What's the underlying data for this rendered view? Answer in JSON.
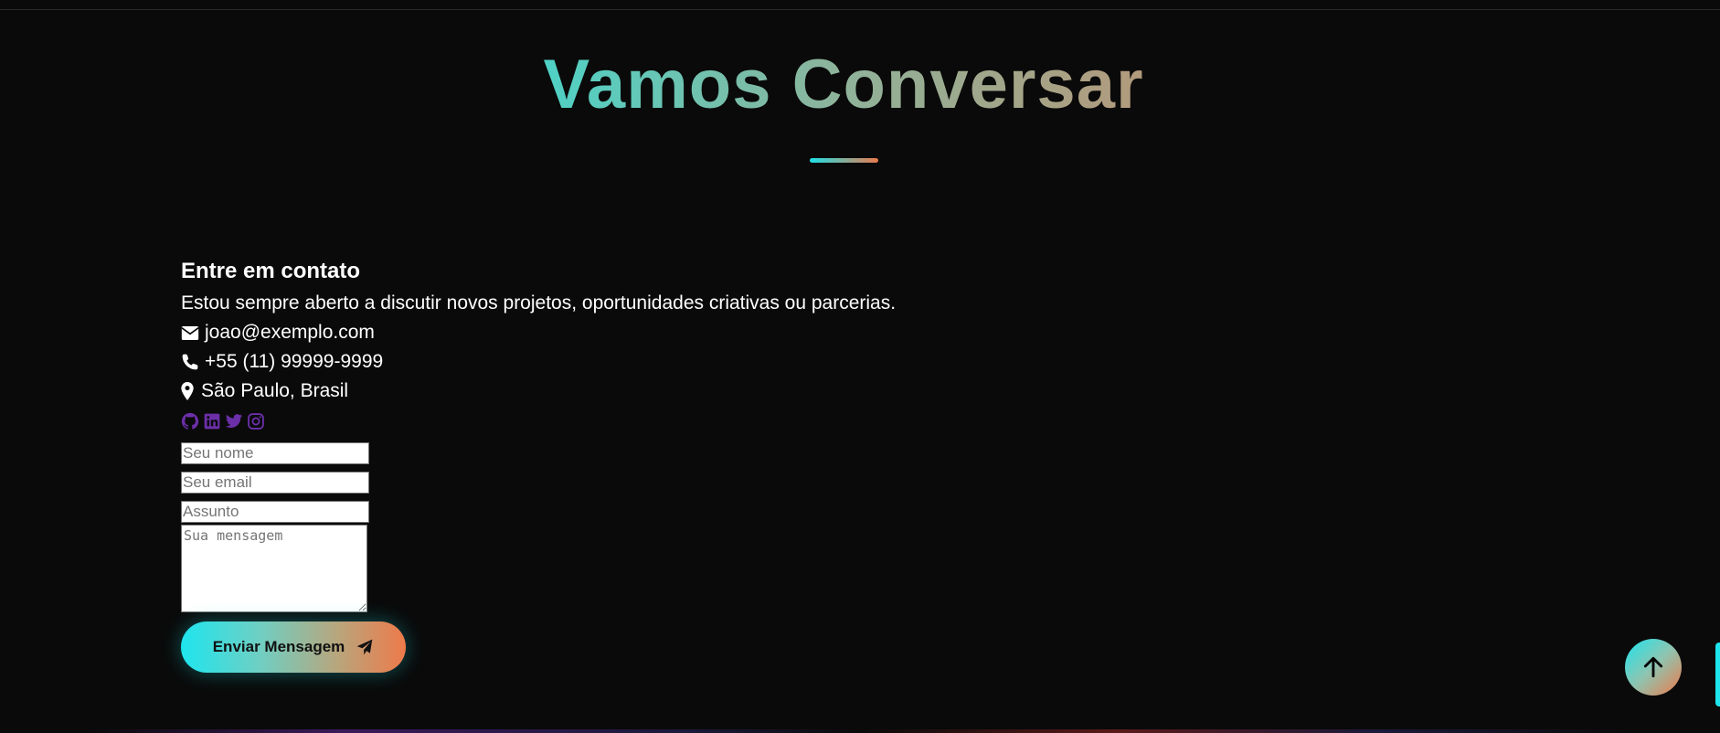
{
  "section": {
    "title": "Vamos Conversar"
  },
  "contact": {
    "heading": "Entre em contato",
    "description": "Estou sempre aberto a discutir novos projetos, oportunidades criativas ou parcerias.",
    "email": "joao@exemplo.com",
    "phone": "+55 (11) 99999-9999",
    "location": "São Paulo, Brasil",
    "socials": [
      "github-icon",
      "linkedin-icon",
      "twitter-icon",
      "instagram-icon"
    ],
    "social_color": "#6b2fa8"
  },
  "form": {
    "name_placeholder": "Seu nome",
    "email_placeholder": "Seu email",
    "subject_placeholder": "Assunto",
    "message_placeholder": "Sua mensagem",
    "submit_label": "Enviar Mensagem"
  },
  "colors": {
    "background": "#0a0a0a",
    "accent_start": "#1ee5ee",
    "accent_end": "#ee7a4a"
  }
}
